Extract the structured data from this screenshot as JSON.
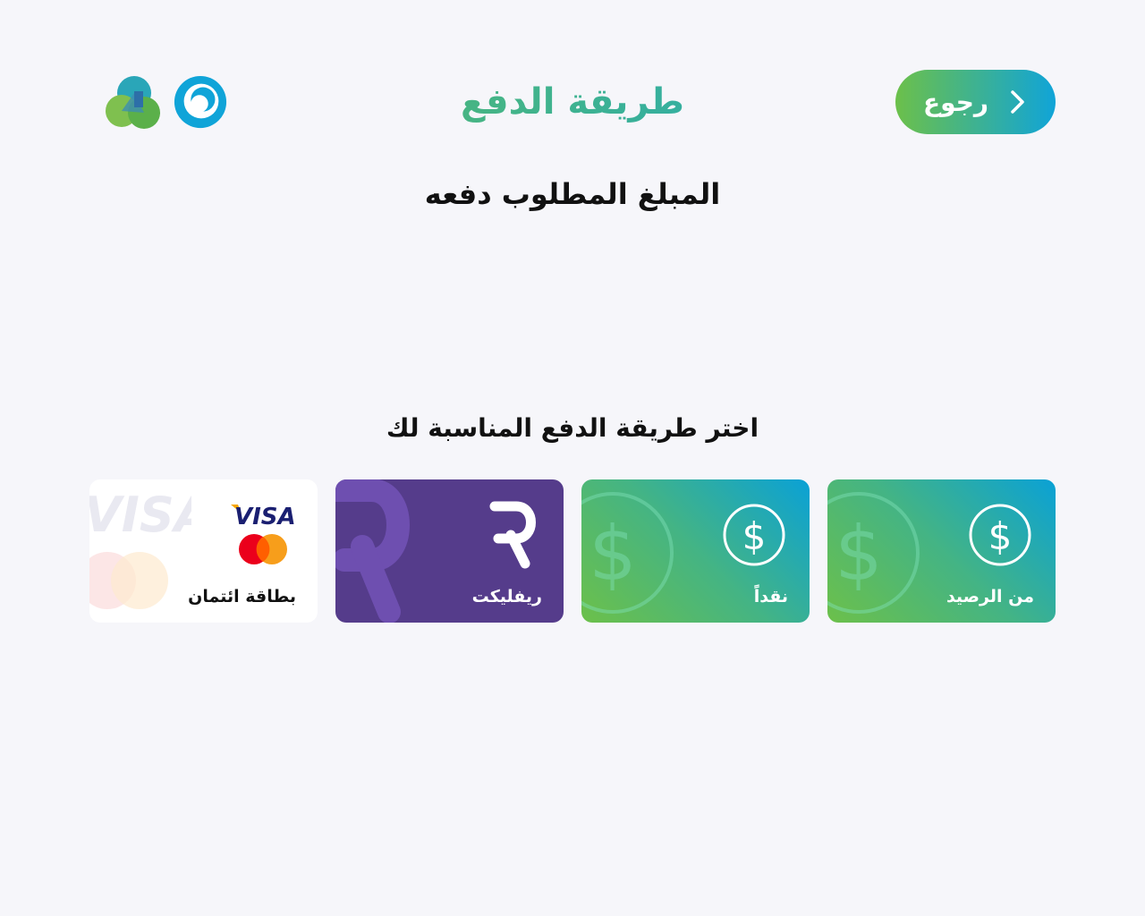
{
  "header": {
    "title": "طريقة الدفع",
    "back_label": "رجوع"
  },
  "amount_label": "المبلغ المطلوب دفعه",
  "choose_label": "اختر طريقة الدفع المناسبة لك",
  "payment_methods": [
    {
      "id": "balance",
      "label": "من الرصيد",
      "icon": "dollar-circle-icon"
    },
    {
      "id": "cash",
      "label": "نقداً",
      "icon": "dollar-circle-icon"
    },
    {
      "id": "reflect",
      "label": "ريفليكت",
      "icon": "reflect-logo-icon"
    },
    {
      "id": "card",
      "label": "بطاقة ائتمان",
      "icon": "visa-mastercard-icon",
      "brand_text": "VISA"
    }
  ],
  "colors": {
    "gradient_start": "#6cc04a",
    "gradient_end": "#10a4d8",
    "purple": "#553c8b",
    "background": "#f6f6fa"
  }
}
